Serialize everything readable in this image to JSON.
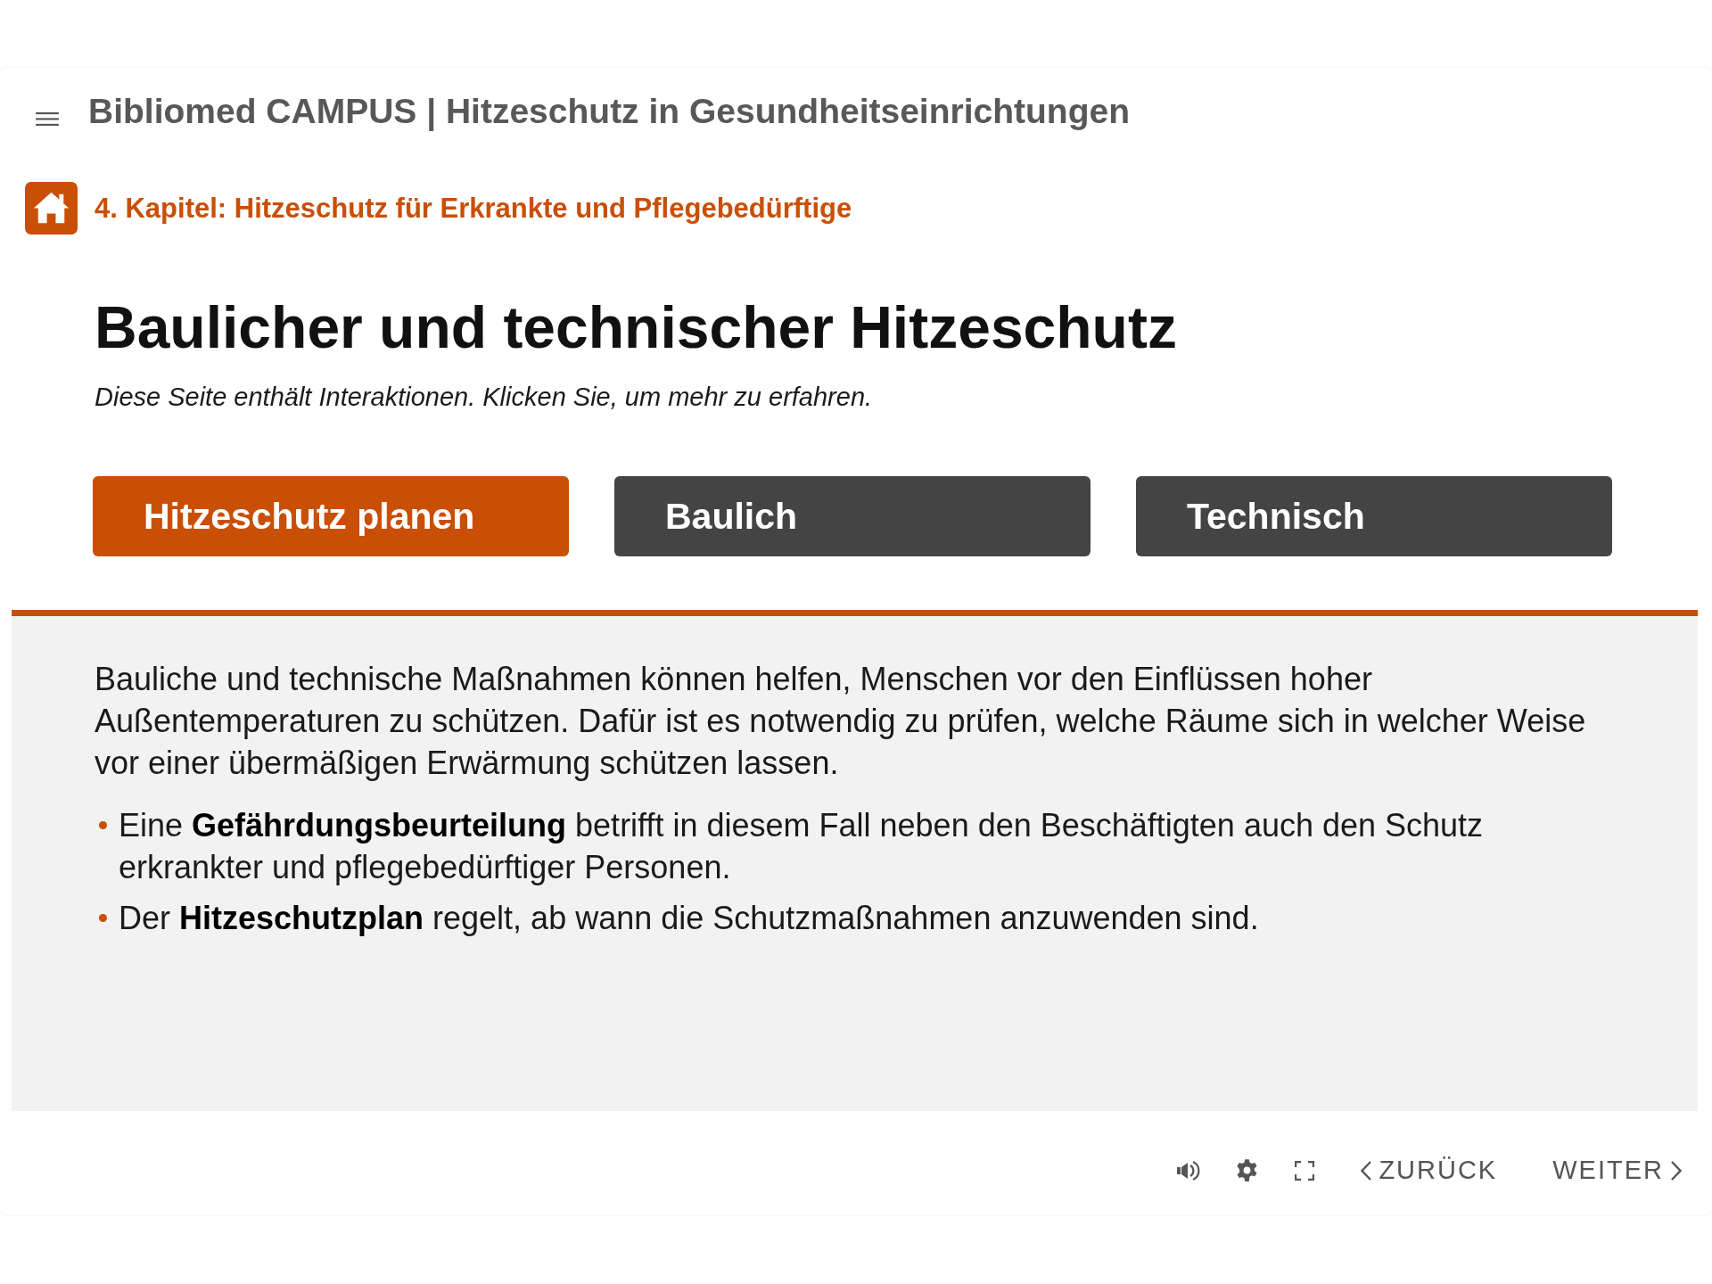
{
  "header": {
    "title": "Bibliomed CAMPUS | Hitzeschutz in Gesundheitseinrichtungen"
  },
  "breadcrumb": {
    "label": "4. Kapitel: Hitzeschutz für Erkrankte und Pflegebedürftige"
  },
  "page": {
    "heading": "Baulicher und technischer Hitzeschutz",
    "hint": "Diese Seite enthält Interaktionen. Klicken Sie, um mehr zu erfahren."
  },
  "tabs": [
    {
      "label": "Hitzeschutz planen",
      "selected": true
    },
    {
      "label": "Baulich",
      "selected": false
    },
    {
      "label": "Technisch",
      "selected": false
    }
  ],
  "panel": {
    "paragraph": "Bauliche und technische Maßnahmen können helfen, Menschen vor den Einflüssen hoher Außentemperaturen zu schützen. Dafür ist es notwendig zu prüfen, welche Räume sich in welcher Weise vor einer übermäßigen Erwärmung schützen lassen.",
    "bullets": [
      "Eine **Gefährdungsbeurteilung** betrifft in diesem Fall neben den Beschäftigten auch den Schutz erkrankter und pflegebedürftiger Personen.",
      "Der **Hitzeschutzplan** regelt, ab wann die Schutzmaßnahmen anzuwenden sind."
    ]
  },
  "footer": {
    "back": "ZURÜCK",
    "next": "WEITER"
  }
}
